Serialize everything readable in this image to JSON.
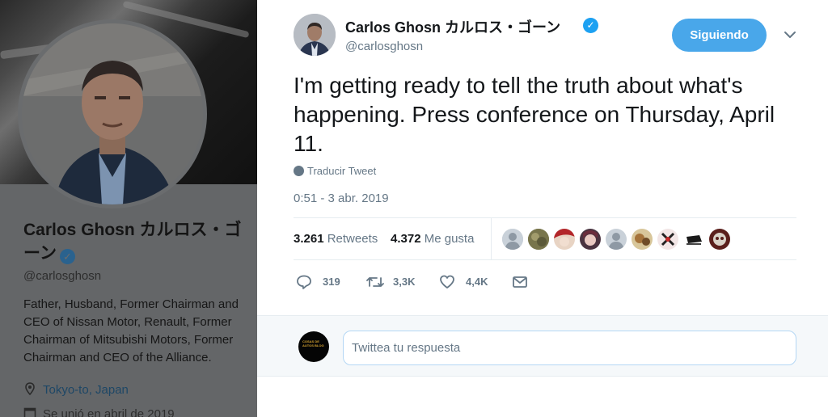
{
  "background_profile": {
    "name": "Carlos Ghosn カルロス・ゴーン",
    "handle": "@carlosghosn",
    "bio": "Father, Husband, Former Chairman and CEO of Nissan Motor, Renault, Former Chairman of Mitsubishi Motors, Former Chairman and CEO of the Alliance.",
    "location": "Tokyo-to, Japan",
    "joined": "Se unió en abril de 2019",
    "verified_icon": "verified-badge-icon"
  },
  "tweet": {
    "author_name": "Carlos Ghosn カルロス・ゴーン",
    "author_handle": "@carlosghosn",
    "follow_label": "Siguiendo",
    "text": "I'm getting ready to tell the truth about what's happening.  Press conference on Thursday, April 11.",
    "translate_label": "Traducir Tweet",
    "timestamp": "0:51 - 3 abr. 2019",
    "stats": {
      "retweets_count": "3.261",
      "retweets_label": "Retweets",
      "likes_count": "4.372",
      "likes_label": "Me gusta"
    },
    "likers_count_shown": 9,
    "actions": {
      "reply_count": "319",
      "retweet_count": "3,3K",
      "like_count": "4,4K"
    },
    "reply_placeholder": "Twittea tu respuesta",
    "reply_avatar_text": "COSAS DE AUTOS BLOG"
  },
  "colors": {
    "accent": "#1da1f2",
    "follow_button": "#49a7ea",
    "secondary_text": "#657786",
    "primary_text": "#14171a"
  },
  "icons": [
    "verified-badge-icon",
    "chevron-down-icon",
    "globe-icon",
    "reply-icon",
    "retweet-icon",
    "heart-icon",
    "message-icon",
    "location-pin-icon",
    "calendar-icon"
  ]
}
